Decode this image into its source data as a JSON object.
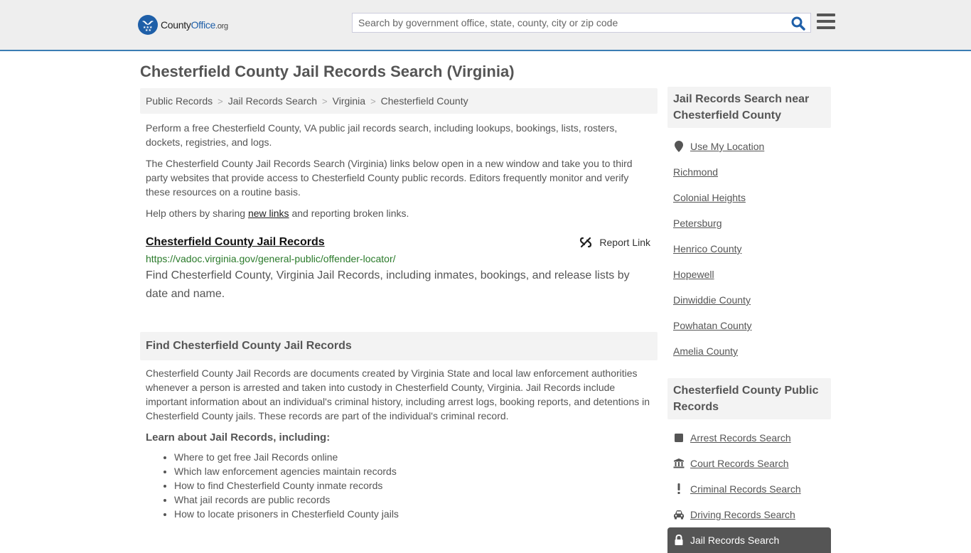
{
  "header": {
    "logo": {
      "name_part1": "County",
      "name_part2": "Office",
      "name_part3": ".org"
    },
    "search": {
      "placeholder": "Search by government office, state, county, city or zip code",
      "value": ""
    },
    "colors": {
      "brand": "#1e5fa8",
      "header_border": "#3b7db3"
    }
  },
  "page": {
    "title": "Chesterfield County Jail Records Search (Virginia)",
    "breadcrumb": [
      "Public Records",
      "Jail Records Search",
      "Virginia",
      "Chesterfield County"
    ],
    "intro": {
      "p1": "Perform a free Chesterfield County, VA public jail records search, including lookups, bookings, lists, rosters, dockets, registries, and logs.",
      "p2": "The Chesterfield County Jail Records Search (Virginia) links below open in a new window and take you to third party websites that provide access to Chesterfield County public records. Editors frequently monitor and verify these resources on a routine basis.",
      "p3_before": "Help others by sharing ",
      "p3_link": "new links",
      "p3_after": " and reporting broken links."
    },
    "result": {
      "title": "Chesterfield County Jail Records",
      "report_label": "Report Link",
      "url": "https://vadoc.virginia.gov/general-public/offender-locator/",
      "description": "Find Chesterfield County, Virginia Jail Records, including inmates, bookings, and release lists by date and name."
    },
    "find_section": {
      "heading": "Find Chesterfield County Jail Records",
      "body": "Chesterfield County Jail Records are documents created by Virginia State and local law enforcement authorities whenever a person is arrested and taken into custody in Chesterfield County, Virginia. Jail Records include important information about an individual's criminal history, including arrest logs, booking reports, and detentions in Chesterfield County jails. These records are part of the individual's criminal record.",
      "learn_heading": "Learn about Jail Records, including:",
      "learn_items": [
        "Where to get free Jail Records online",
        "Which law enforcement agencies maintain records",
        "How to find Chesterfield County inmate records",
        "What jail records are public records",
        "How to locate prisoners in Chesterfield County jails"
      ]
    }
  },
  "sidebar": {
    "nearby": {
      "heading": "Jail Records Search near Chesterfield County",
      "use_location": "Use My Location",
      "places": [
        "Richmond",
        "Colonial Heights",
        "Petersburg",
        "Henrico County",
        "Hopewell",
        "Dinwiddie County",
        "Powhatan County",
        "Amelia County"
      ]
    },
    "public_records": {
      "heading": "Chesterfield County Public Records",
      "items": [
        {
          "label": "Arrest Records Search",
          "icon": "square-icon"
        },
        {
          "label": "Court Records Search",
          "icon": "courthouse-icon"
        },
        {
          "label": "Criminal Records Search",
          "icon": "exclamation-icon"
        },
        {
          "label": "Driving Records Search",
          "icon": "car-icon"
        },
        {
          "label": "Jail Records Search",
          "icon": "lock-icon",
          "active": true
        }
      ]
    }
  }
}
